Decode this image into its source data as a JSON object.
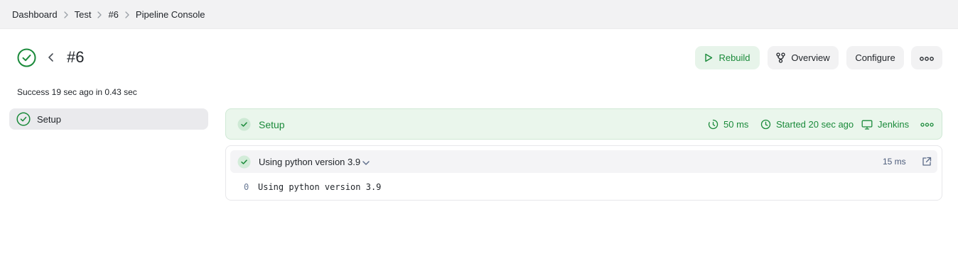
{
  "breadcrumb": [
    "Dashboard",
    "Test",
    "#6",
    "Pipeline Console"
  ],
  "run": {
    "title": "#6",
    "summary": "Success 19 sec ago in 0.43 sec"
  },
  "actions": {
    "rebuild": "Rebuild",
    "overview": "Overview",
    "configure": "Configure"
  },
  "sidebar": {
    "items": [
      {
        "label": "Setup",
        "status": "success"
      }
    ]
  },
  "stage": {
    "name": "Setup",
    "duration": "50 ms",
    "started": "Started 20 sec ago",
    "agent": "Jenkins"
  },
  "steps": [
    {
      "label": "Using python version 3.9",
      "duration": "15 ms",
      "log": [
        {
          "num": "0",
          "text": "Using python version 3.9"
        }
      ]
    }
  ],
  "colors": {
    "success": "#1a8a3a",
    "success_bg": "#eaf6ec",
    "topbar_bg": "#f2f2f3"
  }
}
